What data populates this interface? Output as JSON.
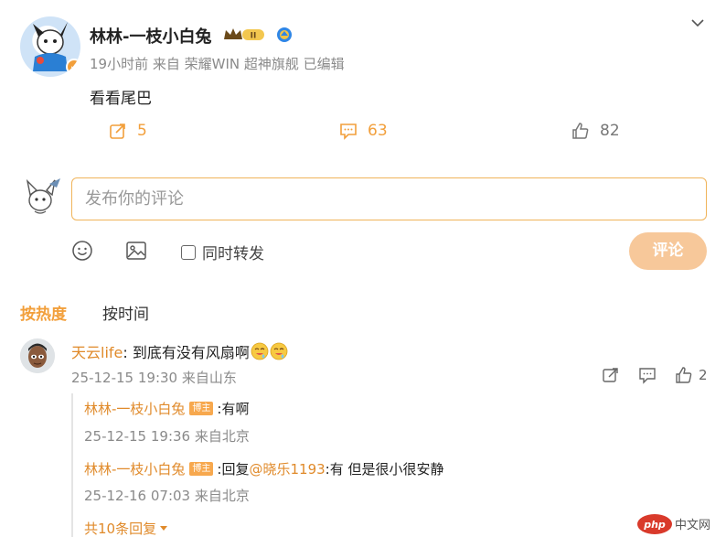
{
  "post": {
    "author": "林林-一枝小白兔",
    "crown_level": "II",
    "meta": "19小时前 来自 荣耀WIN 超神旗舰 已编辑",
    "text": "看看尾巴",
    "repost_count": "5",
    "comment_count": "63",
    "like_count": "82"
  },
  "composer": {
    "placeholder": "发布你的评论",
    "also_repost_label": "同时转发",
    "submit_label": "评论"
  },
  "sort_tabs": {
    "hot": "按热度",
    "time": "按时间"
  },
  "comment": {
    "user": "天云life",
    "text": ": 到底有没有风扇啊",
    "meta": "25-12-15 19:30 来自山东",
    "like_count": "2",
    "replies": [
      {
        "user": "林林-一枝小白兔",
        "tag": "博主",
        "text": ":有啊",
        "meta": "25-12-15 19:36 来自北京"
      },
      {
        "user": "林林-一枝小白兔",
        "tag": "博主",
        "text_prefix": ":回复",
        "mention": "@晓乐1193",
        "text_suffix": ":有 但是很小很安静",
        "meta": "25-12-16 07:03 来自北京"
      }
    ],
    "more_replies": "共10条回复"
  },
  "watermark": "php中文网",
  "colors": {
    "accent": "#f29f3b",
    "username": "#e08a2a",
    "submit_disabled": "#f7c89a",
    "meta_gray": "#8a8a8a"
  }
}
